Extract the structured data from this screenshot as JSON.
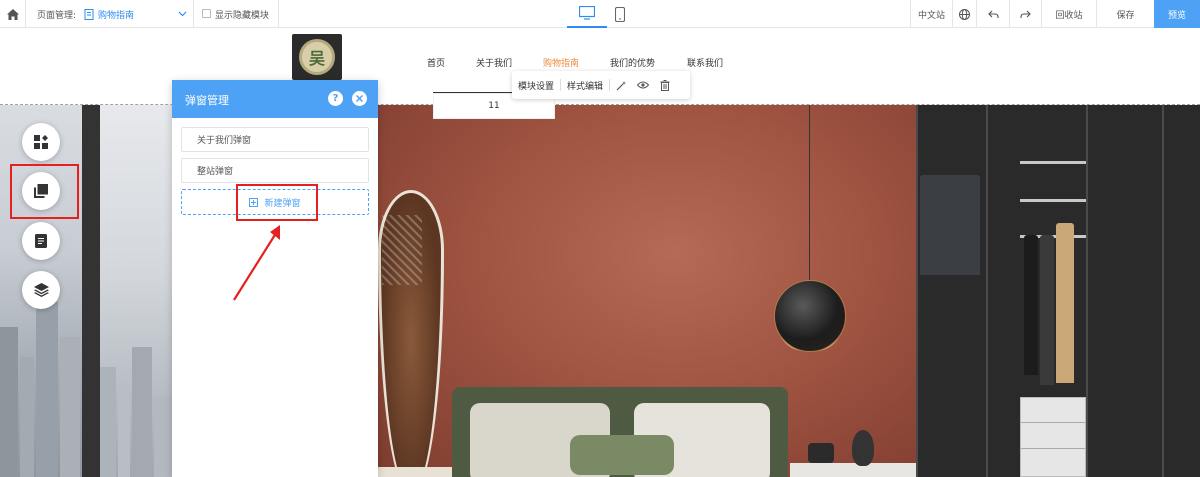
{
  "toolbar": {
    "page_manage_label": "页面管理:",
    "current_page": "购物指南",
    "show_hidden_label": "显示隐藏模块",
    "language": "中文站",
    "recycle_bin": "回收站",
    "save": "保存",
    "preview": "预览"
  },
  "site": {
    "logo_char": "吴",
    "nav": [
      "首页",
      "关于我们",
      "购物指南",
      "我们的优势",
      "联系我们"
    ],
    "active_nav": "购物指南",
    "dropdown_value": "11"
  },
  "module_toolbar": {
    "module_settings": "模块设置",
    "style_edit": "样式编辑"
  },
  "panel": {
    "title": "弹窗管理",
    "help": "?",
    "items": [
      "关于我们弹窗",
      "整站弹窗"
    ],
    "new_button": "新建弹窗"
  },
  "colors": {
    "primary": "#4ea2f5",
    "active_nav": "#f08a3c",
    "highlight": "#e62020"
  },
  "icons": {
    "home": "home-icon",
    "page": "page-icon",
    "desktop": "desktop-icon",
    "mobile": "mobile-icon",
    "globe": "globe-icon",
    "undo": "undo-icon",
    "redo": "redo-icon",
    "modules": "modules-icon",
    "popup": "popup-icon",
    "pages": "document-icon",
    "layers": "layers-icon"
  }
}
